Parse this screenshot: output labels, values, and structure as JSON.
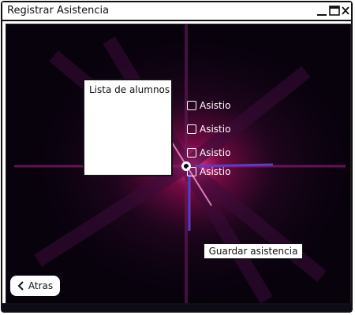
{
  "window": {
    "title": "Registrar Asistencia"
  },
  "window_controls": {
    "minimize": "minimize-icon",
    "maximize": "maximize-icon",
    "close": "close-icon"
  },
  "student_list": {
    "title": "Lista de alumnos"
  },
  "attendance": {
    "checkboxes": [
      {
        "label": "Asistio",
        "checked": false
      },
      {
        "label": "Asistio",
        "checked": false
      },
      {
        "label": "Asistio",
        "checked": false
      },
      {
        "label": "Asistio",
        "checked": false
      }
    ]
  },
  "actions": {
    "save_label": "Guardar asistencia",
    "back_label": "Atras",
    "back_icon": "chevron-left-icon"
  },
  "colors": {
    "background": "#07020c",
    "glow": "#e0207a",
    "streak": "#5a3cc8"
  }
}
